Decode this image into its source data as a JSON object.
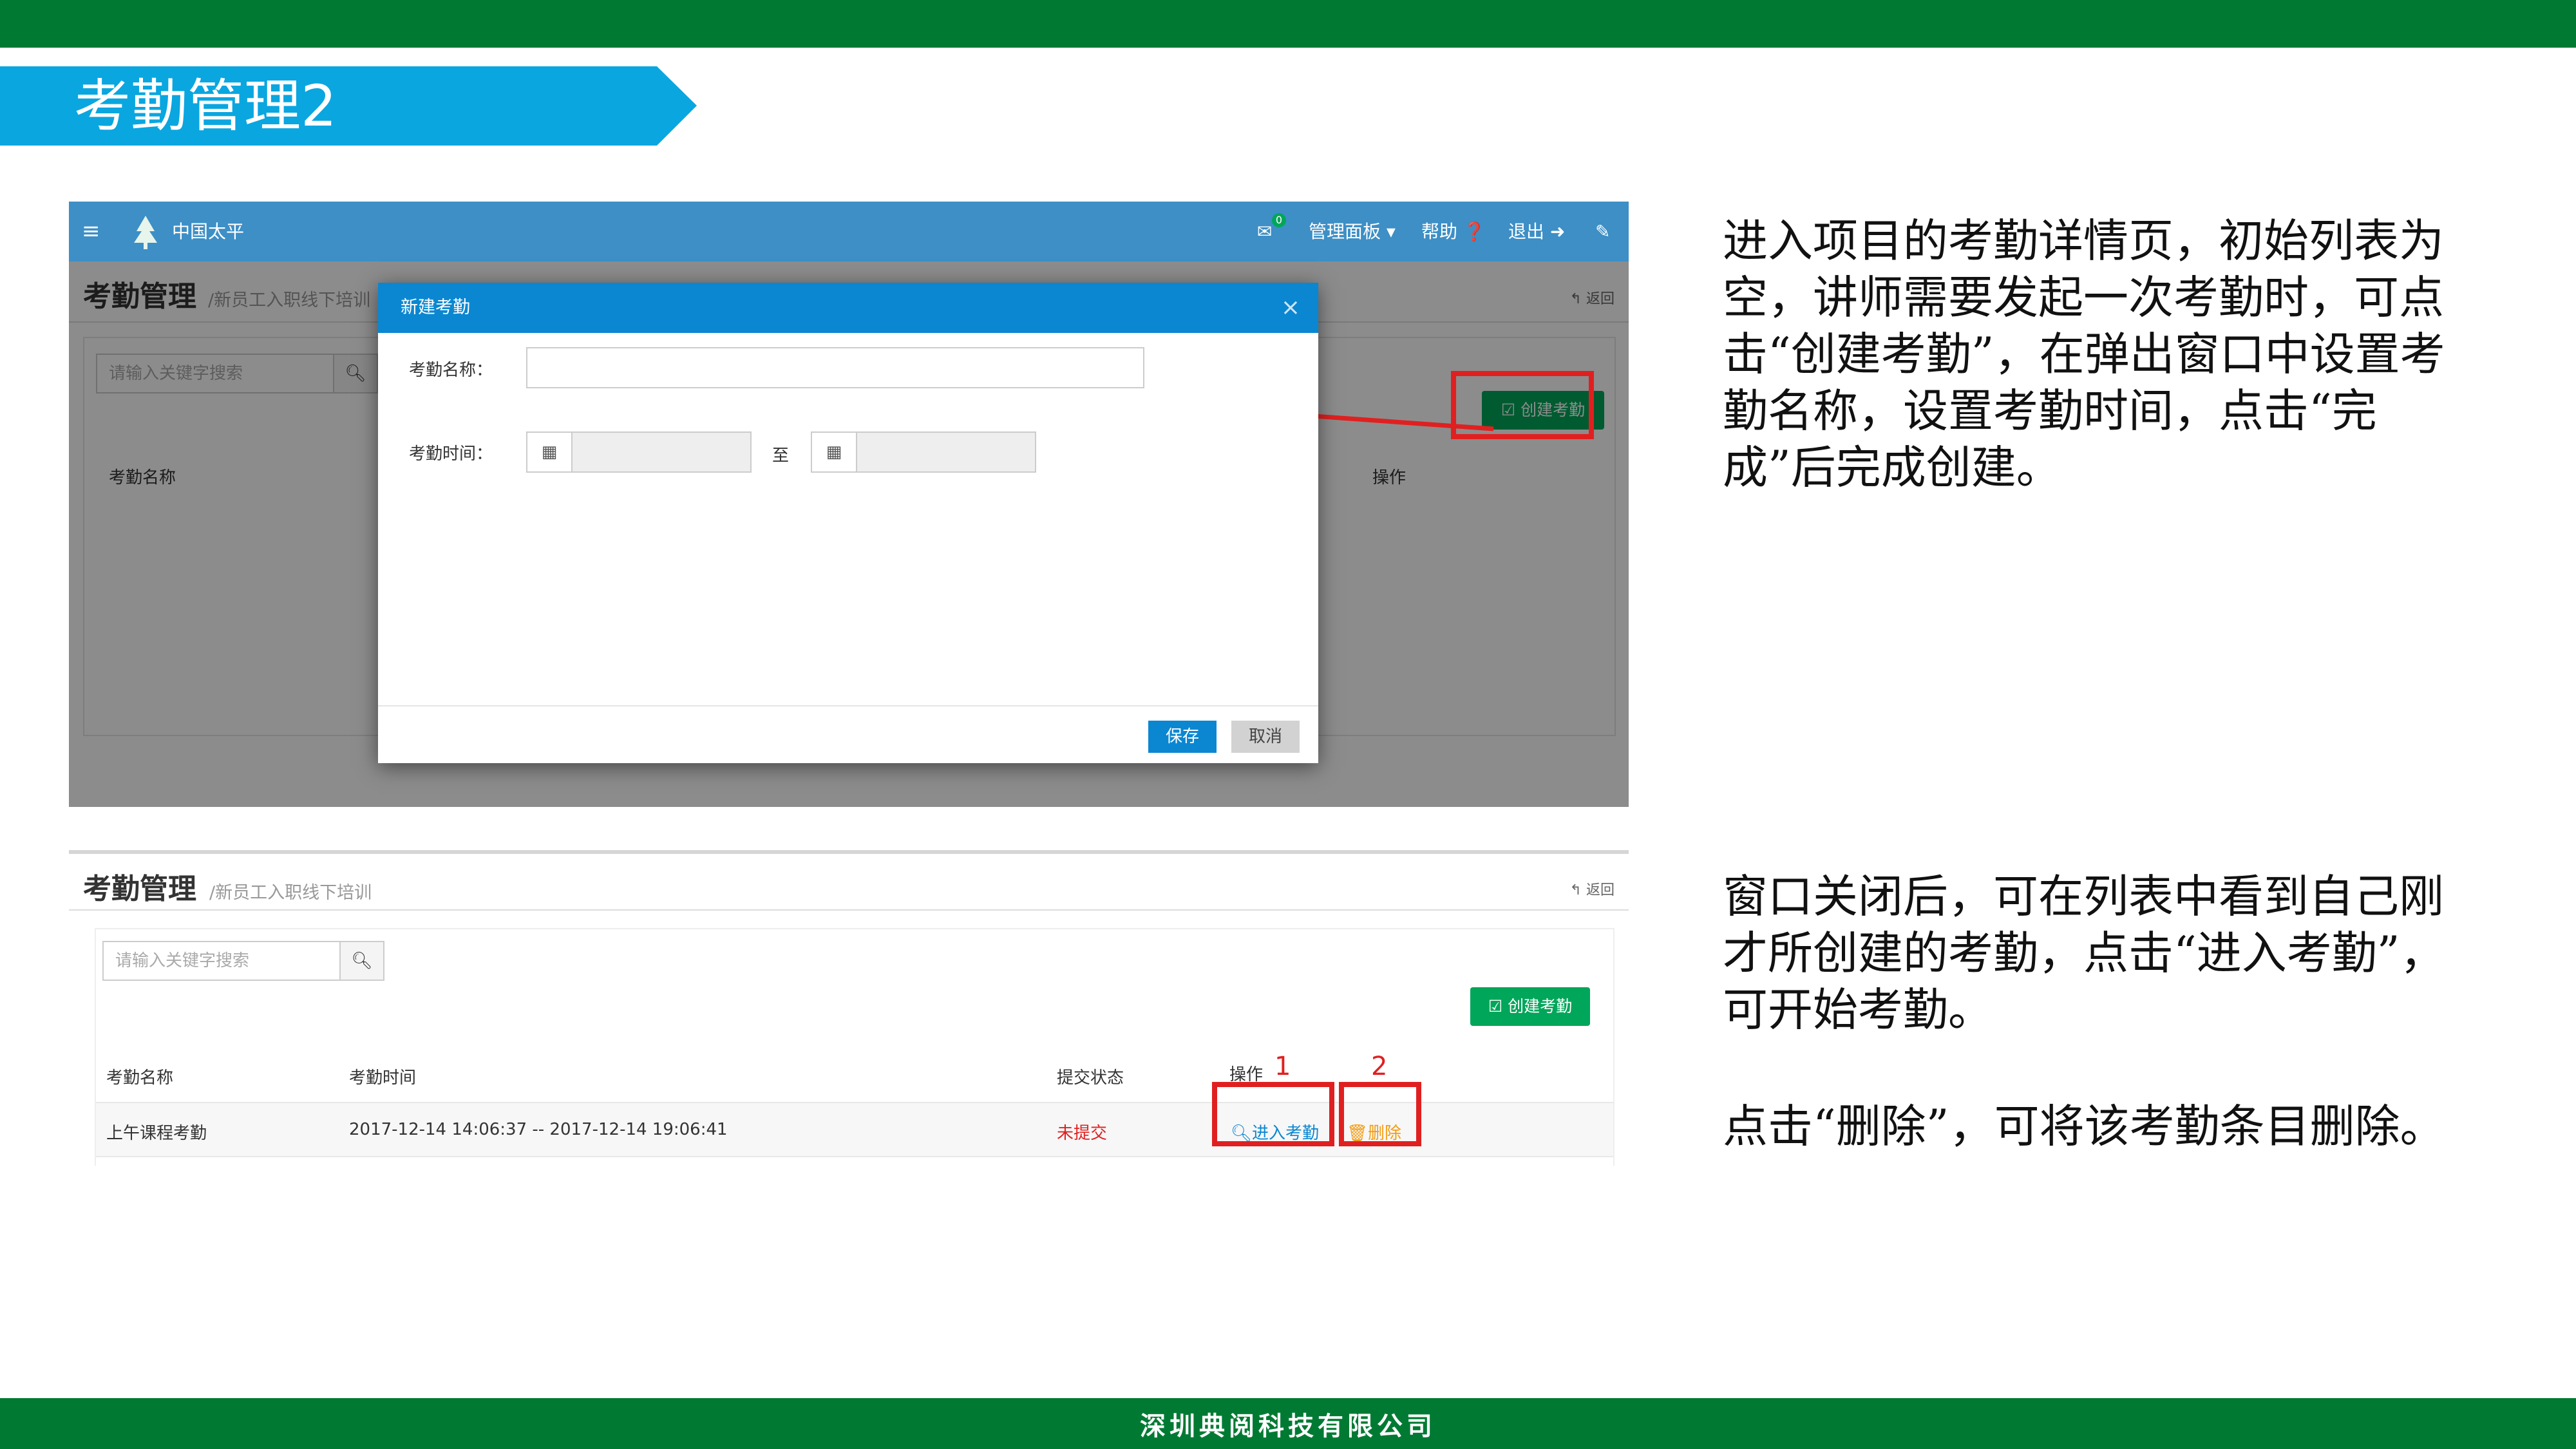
{
  "slide": {
    "title": "考勤管理2",
    "footer": "深圳典阅科技有限公司",
    "colors": {
      "top_bar": "#007a33",
      "title_banner": "#0aa6e0",
      "highlight": "#e02020"
    }
  },
  "screenshot1": {
    "navbar": {
      "menu_icon": "hamburger-icon",
      "logo_icon": "tree-logo-icon",
      "brand": "中国太平",
      "mail_badge": "0",
      "dashboard": "管理面板",
      "help": "帮助",
      "logout": "退出"
    },
    "page": {
      "title": "考勤管理",
      "breadcrumb": "/新员工入职线下培训",
      "back": "返回"
    },
    "search_placeholder": "请输入关键字搜索",
    "create_button": "创建考勤",
    "table_headers": {
      "name": "考勤名称",
      "action": "操作"
    },
    "modal": {
      "title": "新建考勤",
      "close": "×",
      "name_label": "考勤名称：",
      "name_value": "",
      "time_label": "考勤时间：",
      "to": "至",
      "save": "保存",
      "cancel": "取消"
    }
  },
  "screenshot2": {
    "page": {
      "title": "考勤管理",
      "breadcrumb": "/新员工入职线下培训",
      "back": "返回"
    },
    "search_placeholder": "请输入关键字搜索",
    "create_button": "创建考勤",
    "headers": [
      "考勤名称",
      "考勤时间",
      "提交状态",
      "操作"
    ],
    "rows": [
      {
        "name": "上午课程考勤",
        "time": "2017-12-14 14:06:37 -- 2017-12-14 19:06:41",
        "status": "未提交",
        "enter": "进入考勤",
        "delete": "删除"
      }
    ],
    "markers": [
      "1",
      "2"
    ]
  },
  "descriptions": {
    "p1": "进入项目的考勤详情页，初始列表为空，讲师需要发起一次考勤时，可点击“创建考勤”，在弹出窗口中设置考勤名称，设置考勤时间，点击“完成”后完成创建。",
    "p2": "窗口关闭后，可在列表中看到自己刚才所创建的考勤，点击“进入考勤”，可开始考勤。",
    "p3": "点击“删除”，可将该考勤条目删除。"
  }
}
